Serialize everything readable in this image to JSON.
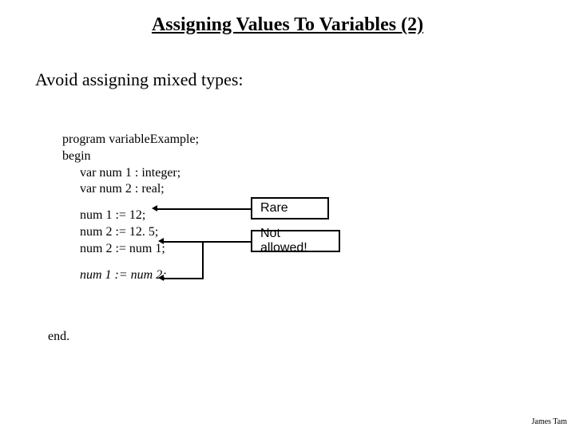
{
  "title": "Assigning Values To Variables (2)",
  "subtitle": "Avoid assigning mixed types:",
  "code": {
    "l1": "program variableExample;",
    "l2": "begin",
    "l3": "var num 1 : integer;",
    "l4": "var num 2 : real;",
    "l5": "num 1 := 12;",
    "l6": "num 2 := 12. 5;",
    "l7": "num 2 := num 1;",
    "l8": "num 1 := num 2;",
    "end": "end."
  },
  "annotations": {
    "rare": "Rare",
    "not_allowed": "Not allowed!"
  },
  "footer": "James Tam"
}
